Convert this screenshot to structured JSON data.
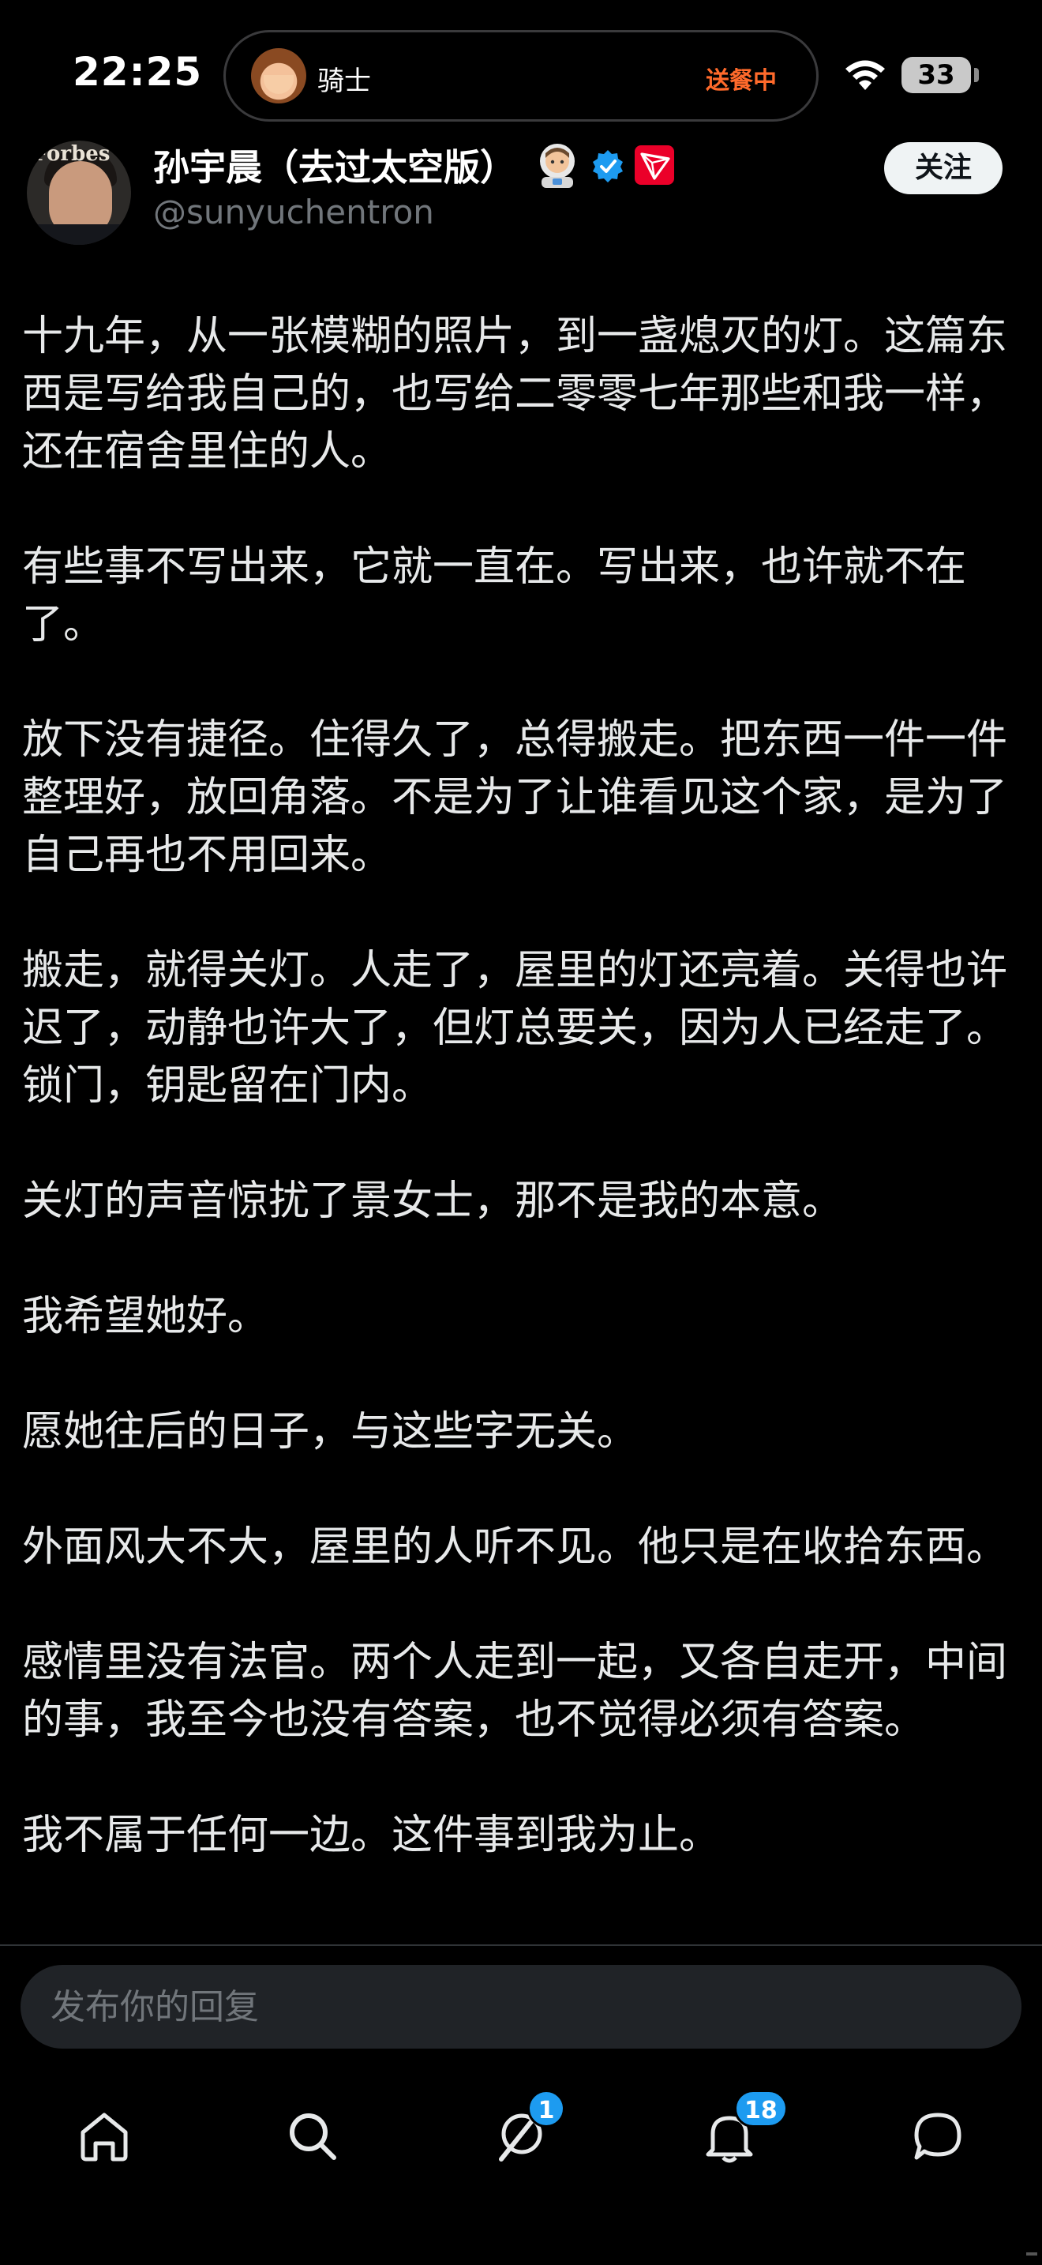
{
  "status_bar": {
    "time": "22:25",
    "live_activity": {
      "app_name": "骑士",
      "status": "送餐中"
    },
    "battery": "33",
    "icons": [
      "wifi-icon",
      "battery-icon"
    ]
  },
  "author": {
    "name": "孙宇晨（去过太空版）",
    "handle": "@sunyuchentron",
    "avatar_text": "Forbes",
    "icons": [
      "astronaut-emoji-icon",
      "verified-badge-icon",
      "tron-logo-icon"
    ],
    "follow_label": "关注"
  },
  "post": {
    "paragraphs": [
      "十九年，从一张模糊的照片，到一盏熄灭的灯。这篇东西是写给我自己的，也写给二零零七年那些和我一样，还在宿舍里住的人。",
      "有些事不写出来，它就一直在。写出来，也许就不在了。",
      "放下没有捷径。住得久了，总得搬走。把东西一件一件整理好，放回角落。不是为了让谁看见这个家，是为了自己再也不用回来。",
      "搬走，就得关灯。人走了，屋里的灯还亮着。关得也许迟了，动静也许大了，但灯总要关，因为人已经走了。锁门，钥匙留在门内。",
      "关灯的声音惊扰了景女士，那不是我的本意。",
      "我希望她好。",
      "愿她往后的日子，与这些字无关。",
      "外面风大不大，屋里的人听不见。他只是在收拾东西。",
      "感情里没有法官。两个人走到一起，又各自走开，中间的事，我至今也没有答案，也不觉得必须有答案。",
      "我不属于任何一边。这件事到我为止。"
    ]
  },
  "reply": {
    "placeholder": "发布你的回复"
  },
  "nav": {
    "items": [
      {
        "name": "home",
        "icon": "home-icon",
        "badge": ""
      },
      {
        "name": "search",
        "icon": "search-icon",
        "badge": ""
      },
      {
        "name": "grok",
        "icon": "grok-icon",
        "badge": "1"
      },
      {
        "name": "notifications",
        "icon": "bell-icon",
        "badge": "18"
      },
      {
        "name": "messages",
        "icon": "chat-bubble-icon",
        "badge": ""
      }
    ]
  },
  "colors": {
    "background": "#000000",
    "text": "#e7e9ea",
    "secondary": "#71767b",
    "accent": "#1d9bf0",
    "delivery_orange": "#ff6a2b"
  }
}
